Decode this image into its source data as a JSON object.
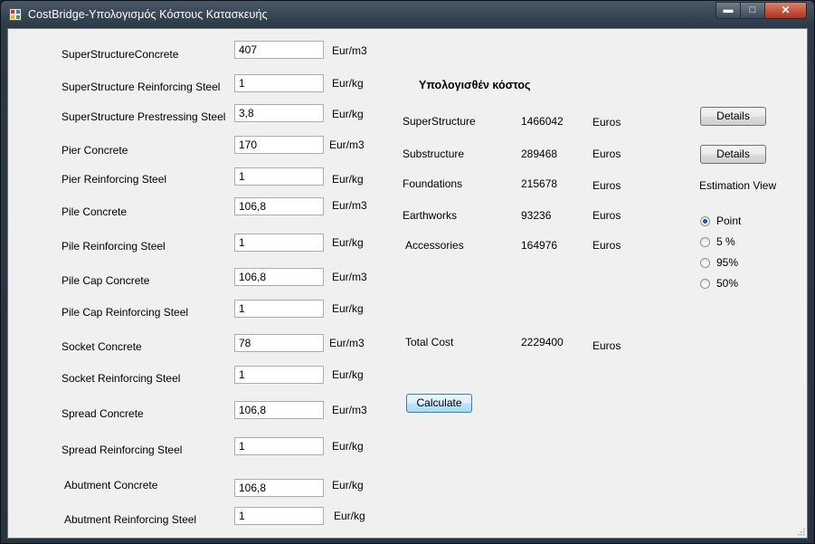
{
  "window": {
    "title": "CostBridge-Υπολογισμός Κόστους Κατασκευής"
  },
  "inputs": [
    {
      "label": "SuperStructureConcrete",
      "value": "407",
      "unit": "Eur/m3"
    },
    {
      "label": "SuperStructure Reinforcing Steel",
      "value": "1",
      "unit": "Eur/kg"
    },
    {
      "label": "SuperStructure Prestressing Steel",
      "value": "3,8",
      "unit": "Eur/kg"
    },
    {
      "label": "Pier Concrete",
      "value": "170",
      "unit": "Eur/m3"
    },
    {
      "label": "Pier Reinforcing Steel",
      "value": "1",
      "unit": "Eur/kg"
    },
    {
      "label": "Pile Concrete",
      "value": "106,8",
      "unit": "Eur/m3"
    },
    {
      "label": "Pile Reinforcing Steel",
      "value": "1",
      "unit": "Eur/kg"
    },
    {
      "label": "Pile Cap Concrete",
      "value": "106,8",
      "unit": "Eur/m3"
    },
    {
      "label": "Pile Cap Reinforcing Steel",
      "value": "1",
      "unit": "Eur/kg"
    },
    {
      "label": "Socket Concrete",
      "value": "78",
      "unit": "Eur/m3"
    },
    {
      "label": "Socket Reinforcing Steel",
      "value": "1",
      "unit": "Eur/kg"
    },
    {
      "label": "Spread Concrete",
      "value": "106,8",
      "unit": "Eur/m3"
    },
    {
      "label": "Spread Reinforcing Steel",
      "value": "1",
      "unit": "Eur/kg"
    },
    {
      "label": "Abutment Concrete",
      "value": "106,8",
      "unit": "Eur/kg"
    },
    {
      "label": "Abutment Reinforcing Steel",
      "value": "1",
      "unit": "Eur/kg"
    }
  ],
  "results": {
    "heading": "Υπολογισθέν κόστος",
    "rows": [
      {
        "label": "SuperStructure",
        "value": "1466042",
        "unit": "Euros"
      },
      {
        "label": "Substructure",
        "value": "289468",
        "unit": "Euros"
      },
      {
        "label": "Foundations",
        "value": "215678",
        "unit": "Euros"
      },
      {
        "label": "Earthworks",
        "value": "93236",
        "unit": "Euros"
      },
      {
        "label": "Accessories",
        "value": "164976",
        "unit": "Euros"
      }
    ],
    "total": {
      "label": "Total Cost",
      "value": "2229400",
      "unit": "Euros"
    }
  },
  "buttons": {
    "details_1": "Details",
    "details_2": "Details",
    "calculate": "Calculate"
  },
  "estimation": {
    "label": "Estimation View",
    "options": [
      "Point",
      "5 %",
      "95%",
      "50%"
    ],
    "selected": "Point"
  },
  "colors": {
    "accent": "#1e5b9e",
    "window_frame": "#2c3946",
    "client": "#f0f0f0"
  }
}
